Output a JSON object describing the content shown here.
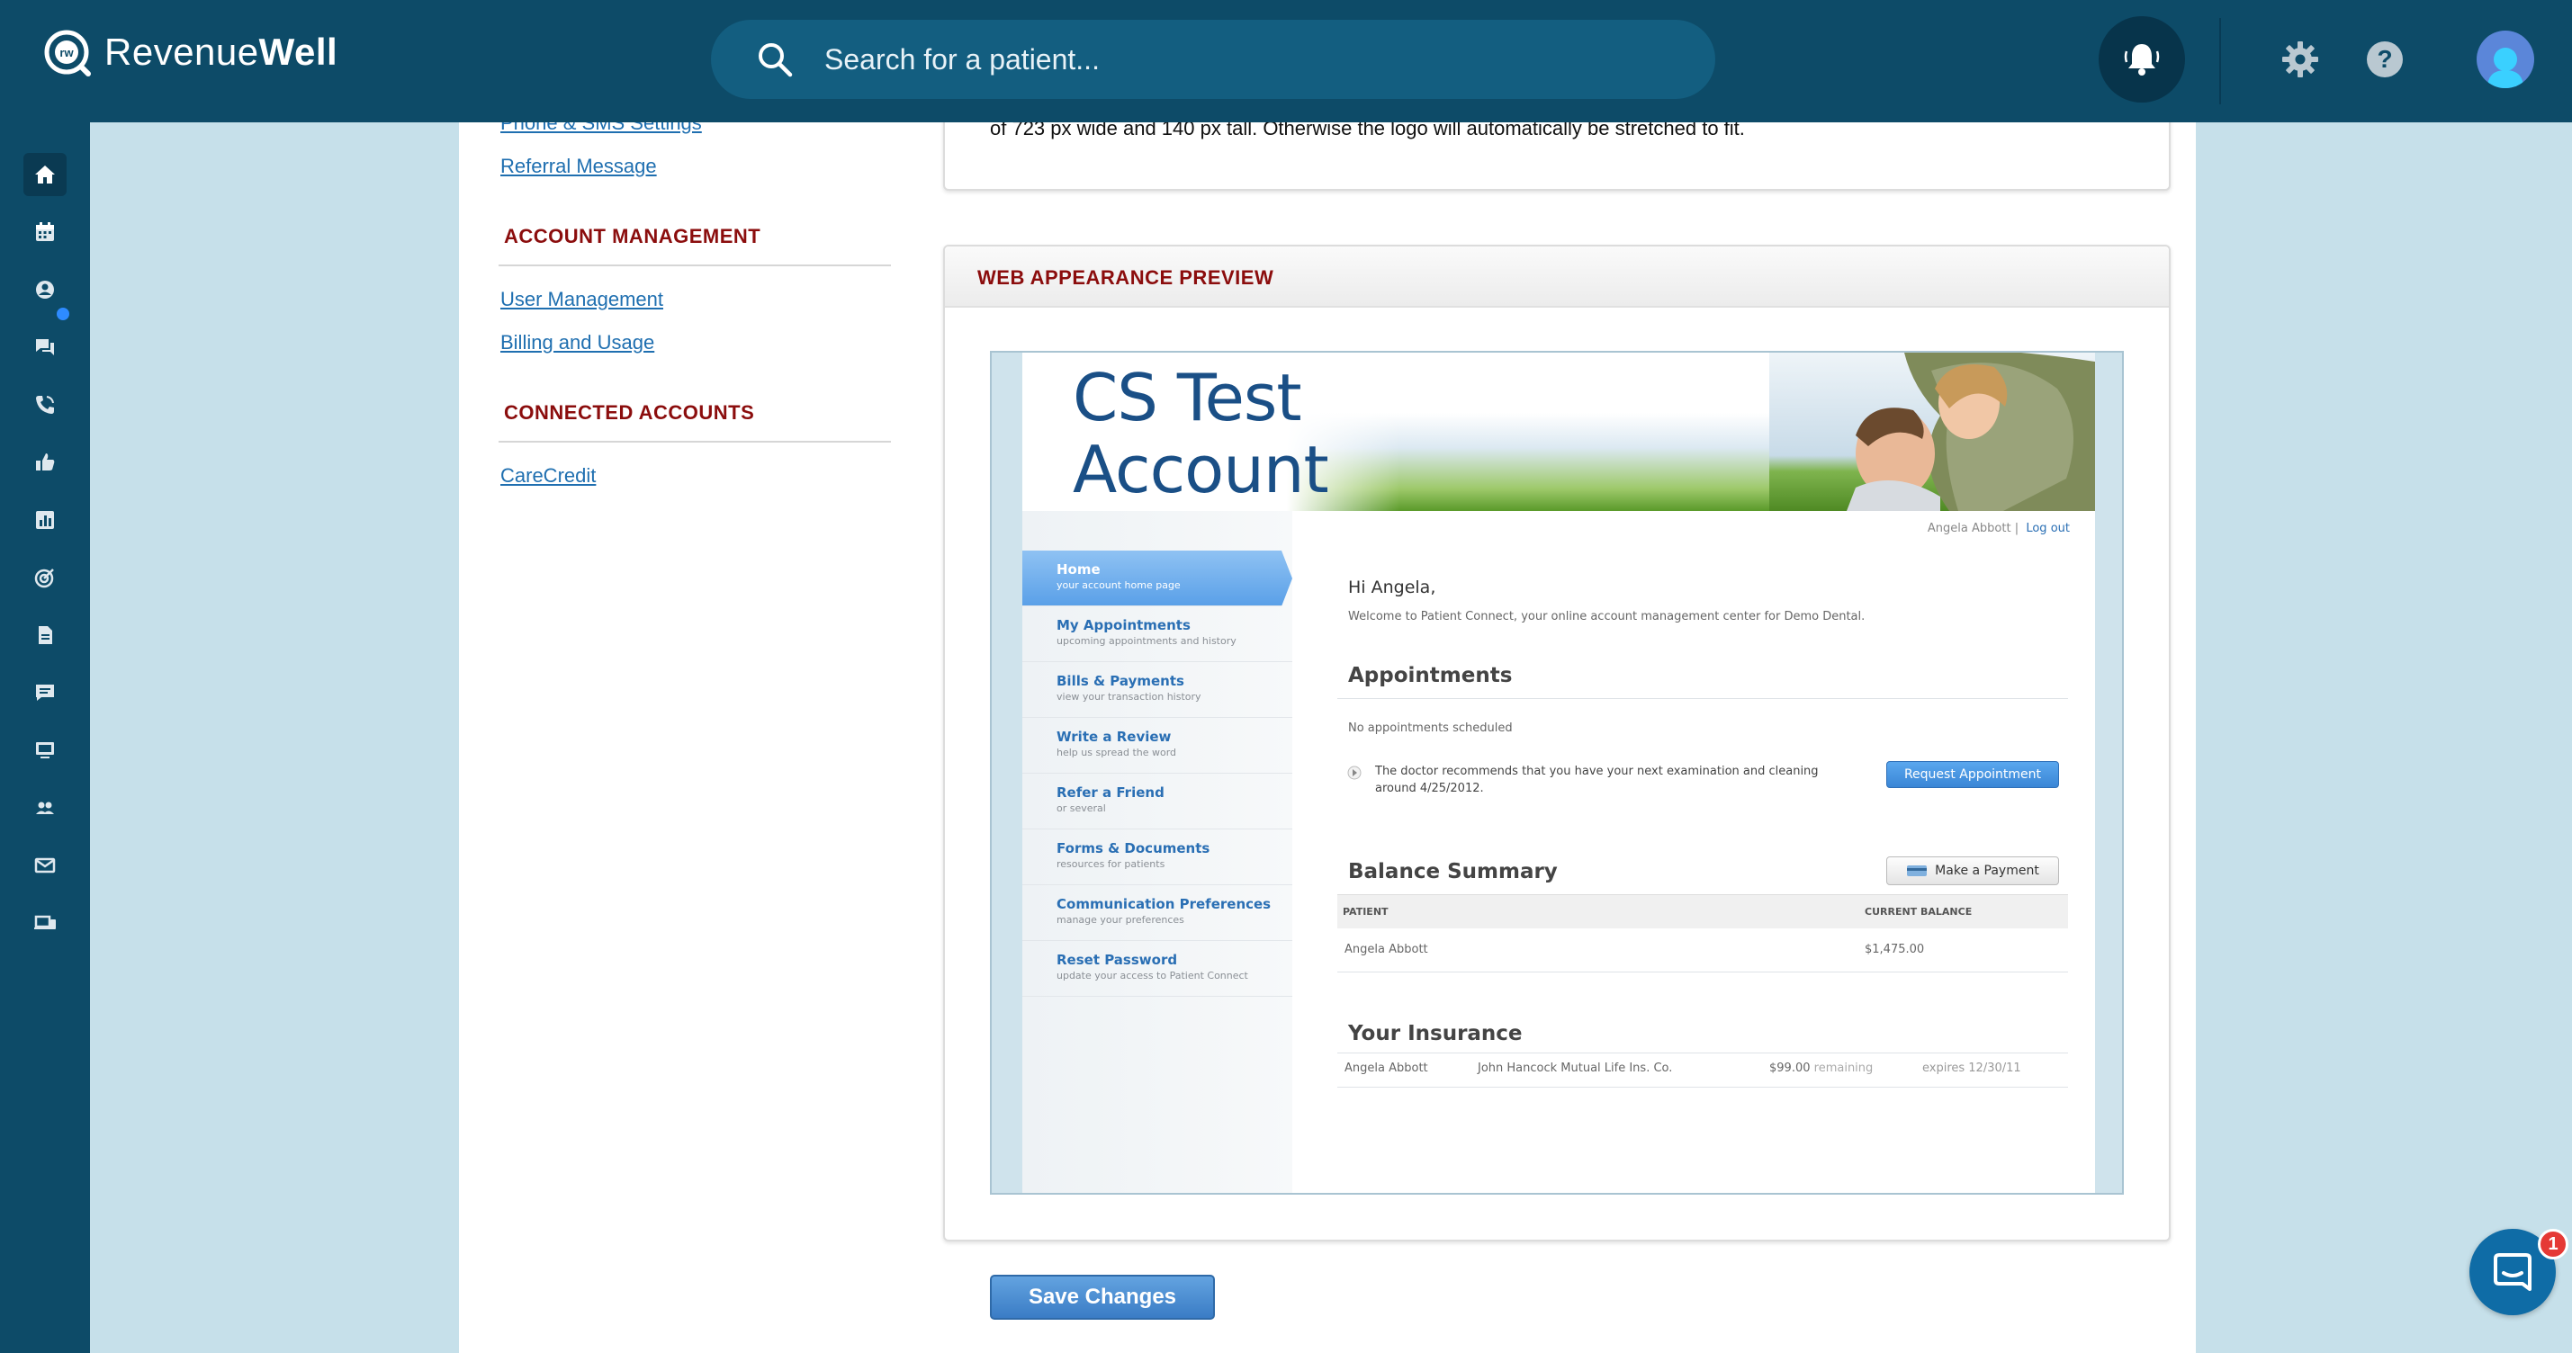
{
  "topbar": {
    "brand_regular": "Revenue",
    "brand_bold": "Well",
    "search_placeholder": "Search for a patient...",
    "icons": [
      "logo-mark-icon",
      "search-icon",
      "bell-icon",
      "gear-icon",
      "help-icon",
      "avatar"
    ]
  },
  "sidebar": {
    "items": [
      {
        "name": "home",
        "icon": "home-icon"
      },
      {
        "name": "schedule",
        "icon": "calendar-icon"
      },
      {
        "name": "patients",
        "icon": "user-icon"
      },
      {
        "name": "messages",
        "icon": "chat-icon"
      },
      {
        "name": "calls",
        "icon": "phone-icon"
      },
      {
        "name": "reviews",
        "icon": "thumbs-up-icon"
      },
      {
        "name": "reports",
        "icon": "bar-chart-icon"
      },
      {
        "name": "campaigns",
        "icon": "target-icon"
      },
      {
        "name": "forms",
        "icon": "document-icon"
      },
      {
        "name": "feedback",
        "icon": "comment-icon"
      },
      {
        "name": "display",
        "icon": "monitor-icon"
      },
      {
        "name": "team",
        "icon": "group-icon"
      },
      {
        "name": "email",
        "icon": "mail-icon"
      },
      {
        "name": "devices",
        "icon": "devices-icon"
      }
    ]
  },
  "settings_nav": {
    "links_top": [
      "Phone & SMS Settings",
      "Referral Message"
    ],
    "account_management": {
      "heading": "ACCOUNT MANAGEMENT",
      "links": [
        "User Management",
        "Billing and Usage"
      ]
    },
    "connected_accounts": {
      "heading": "CONNECTED ACCOUNTS",
      "links": [
        "CareCredit"
      ]
    }
  },
  "logo_card": {
    "text": "of 723 px wide and 140 px tall. Otherwise the logo will automatically be stretched to fit."
  },
  "preview": {
    "heading": "WEB APPEARANCE PREVIEW",
    "account_title_line1": "CS Test",
    "account_title_line2": "Account",
    "user_name": "Angela Abbott",
    "separator": "|",
    "logout": "Log out",
    "nav": [
      {
        "title": "Home",
        "sub": "your account home page",
        "active": true
      },
      {
        "title": "My Appointments",
        "sub": "upcoming appointments and history"
      },
      {
        "title": "Bills & Payments",
        "sub": "view your transaction history"
      },
      {
        "title": "Write a Review",
        "sub": "help us spread the word"
      },
      {
        "title": "Refer a Friend",
        "sub": "or several"
      },
      {
        "title": "Forms & Documents",
        "sub": "resources for patients"
      },
      {
        "title": "Communication Preferences",
        "sub": "manage your preferences"
      },
      {
        "title": "Reset Password",
        "sub": "update your access to Patient Connect"
      }
    ],
    "greeting": "Hi Angela,",
    "welcome": "Welcome to Patient Connect, your online account management center for Demo Dental.",
    "appointments_heading": "Appointments",
    "no_appointments": "No appointments scheduled",
    "recommendation_line1": "The doctor recommends that you have your next examination and cleaning",
    "recommendation_line2": "around 4/25/2012.",
    "request_button": "Request Appointment",
    "balance_heading": "Balance Summary",
    "payment_button": "Make a Payment",
    "col_patient": "PATIENT",
    "col_balance": "CURRENT BALANCE",
    "balance_patient": "Angela Abbott",
    "balance_amount": "$1,475.00",
    "insurance_heading": "Your Insurance",
    "ins_patient": "Angela Abbott",
    "ins_company": "John Hancock Mutual Life Ins. Co.",
    "ins_remaining": "$99.00",
    "ins_remaining_label": "remaining",
    "ins_expires": "expires 12/30/11"
  },
  "save_button": "Save Changes",
  "chat": {
    "badge_count": "1"
  },
  "colors": {
    "topbar": "#0d4b68",
    "accent_red": "#8b0d0d",
    "link": "#1f6fb0",
    "background": "#c6e0ea"
  }
}
